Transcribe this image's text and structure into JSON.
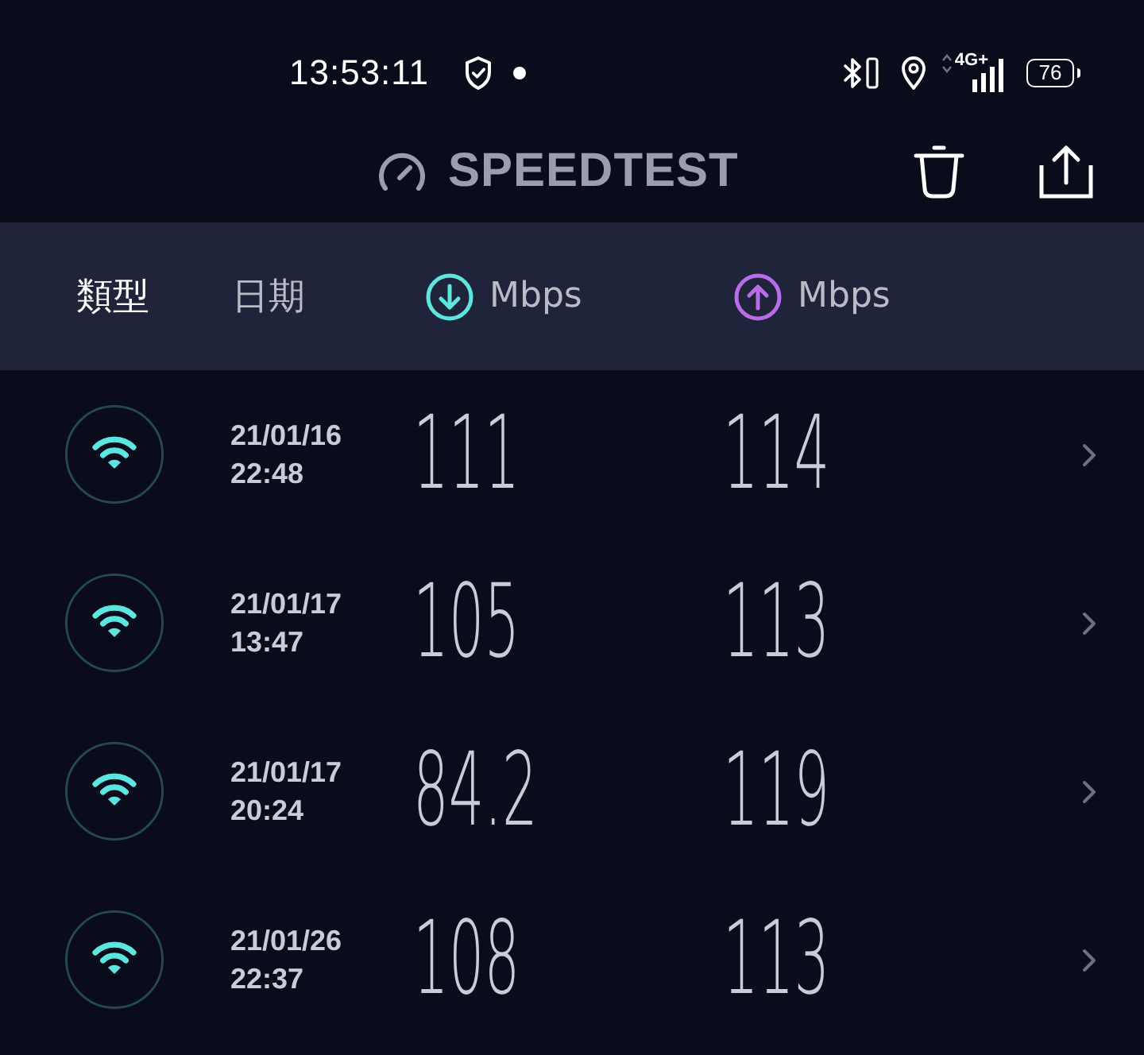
{
  "status_bar": {
    "time": "13:53:11",
    "network": "4G+",
    "battery": "76"
  },
  "app_bar": {
    "title": "SPEEDTEST"
  },
  "columns": [
    {
      "label": "類型",
      "kind": "text",
      "selected": true
    },
    {
      "label": "日期",
      "kind": "text",
      "selected": false
    },
    {
      "label": "Mbps",
      "kind": "download",
      "selected": false
    },
    {
      "label": "Mbps",
      "kind": "upload",
      "selected": false
    }
  ],
  "results": [
    {
      "date": "21/01/16",
      "time": "22:48",
      "download": "111",
      "upload": "114"
    },
    {
      "date": "21/01/17",
      "time": "13:47",
      "download": "105",
      "upload": "113"
    },
    {
      "date": "21/01/17",
      "time": "20:24",
      "download": "84.2",
      "upload": "119"
    },
    {
      "date": "21/01/26",
      "time": "22:37",
      "download": "108",
      "upload": "113"
    }
  ]
}
